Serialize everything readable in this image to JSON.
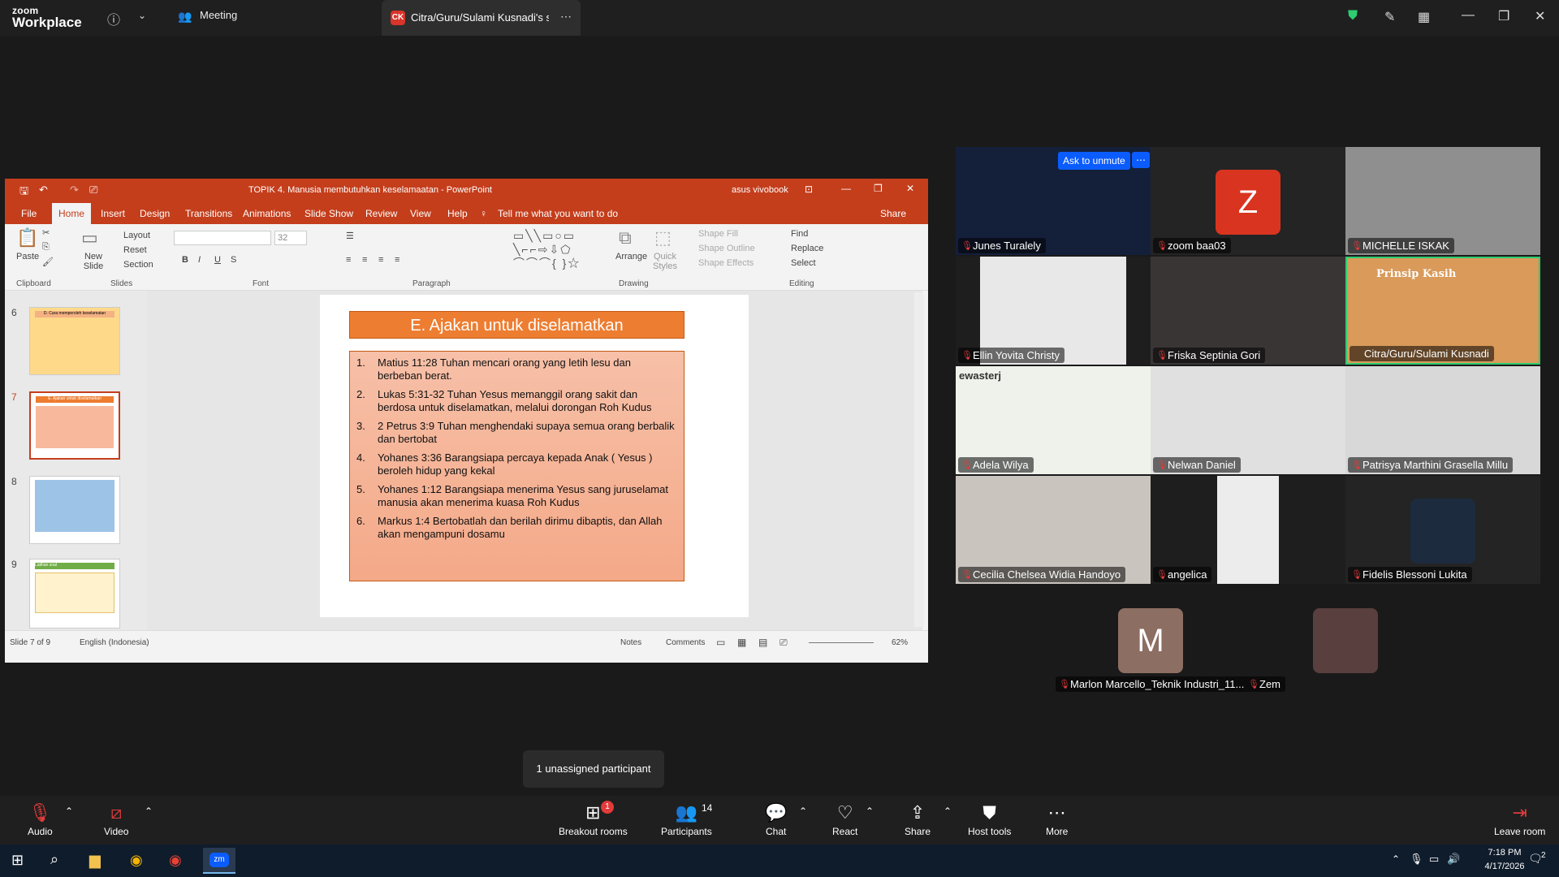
{
  "zoom": {
    "brand_line1": "zoom",
    "brand_line2": "Workplace",
    "meeting_tab": "Meeting",
    "share_tab_badge": "CK",
    "share_tab_label": "Citra/Guru/Sulami Kusnadi's scree"
  },
  "ppt": {
    "window_title": "TOPIK 4. Manusia membutuhkan keselamaatan  -  PowerPoint",
    "user": "asus vivobook",
    "menu": [
      "File",
      "Home",
      "Insert",
      "Design",
      "Transitions",
      "Animations",
      "Slide Show",
      "Review",
      "View",
      "Help"
    ],
    "tell_me": "Tell me what you want to do",
    "share": "Share",
    "ribbon": {
      "paste": "Paste",
      "new_slide": "New Slide",
      "layout": "Layout",
      "reset": "Reset",
      "section": "Section",
      "font_size": "32",
      "arrange": "Arrange",
      "quick_styles": "Quick Styles",
      "shape_fill": "Shape Fill",
      "shape_outline": "Shape Outline",
      "shape_effects": "Shape Effects",
      "find": "Find",
      "replace": "Replace",
      "select": "Select",
      "groups": [
        "Clipboard",
        "Slides",
        "Font",
        "Paragraph",
        "Drawing",
        "Editing"
      ]
    },
    "thumbnails": [
      {
        "num": "6",
        "title": "D. Cara memperoleh keselamatan"
      },
      {
        "num": "7",
        "title": "E. Ajakan untuk diselamatkan"
      },
      {
        "num": "8",
        "title": ""
      },
      {
        "num": "9",
        "title": "Latihan soal"
      }
    ],
    "slide": {
      "title": "E. Ajakan untuk diselamatkan",
      "items": [
        {
          "n": "1.",
          "text": "Matius 11:28  Tuhan mencari orang yang letih lesu dan berbeban berat."
        },
        {
          "n": "2.",
          "text": "Lukas 5:31-32 Tuhan Yesus memanggil orang sakit dan berdosa untuk diselamatkan, melalui dorongan Roh Kudus"
        },
        {
          "n": "3.",
          "text": "2 Petrus 3:9  Tuhan menghendaki supaya semua orang berbalik dan bertobat"
        },
        {
          "n": "4.",
          "text": "Yohanes 3:36 Barangsiapa percaya kepada Anak ( Yesus ) beroleh hidup yang kekal"
        },
        {
          "n": "5.",
          "text": "Yohanes 1:12 Barangsiapa menerima Yesus sang juruselamat manusia akan menerima kuasa Roh Kudus"
        },
        {
          "n": "6.",
          "text": "Markus 1:4 Bertobatlah dan berilah dirimu dibaptis, dan Allah akan mengampuni dosamu"
        }
      ]
    },
    "status": {
      "slide_of": "Slide 7 of 9",
      "language": "English (Indonesia)",
      "notes": "Notes",
      "comments": "Comments",
      "zoom": "62%"
    }
  },
  "gallery": {
    "ask_unmute": "Ask to unmute",
    "participants": [
      {
        "name": "Junes Turalely"
      },
      {
        "name": "zoom baa03",
        "initial": "Z"
      },
      {
        "name": "MICHELLE ISKAK"
      },
      {
        "name": "Ellin Yovita Christy"
      },
      {
        "name": "Friska Septinia Gori"
      },
      {
        "name": "Citra/Guru/Sulami Kusnadi",
        "overlay": "Prinsip Kasih"
      },
      {
        "name": "Adela Wilya",
        "overlay": "ewasterj"
      },
      {
        "name": "Nelwan Daniel"
      },
      {
        "name": "Patrisya Marthini Grasella Millu"
      },
      {
        "name": "Cecilia Chelsea Widia Handoyo"
      },
      {
        "name": "angelica"
      },
      {
        "name": "Fidelis Blessoni Lukita"
      },
      {
        "name": "Marlon Marcello_Teknik Industri_11...",
        "initial": "M"
      },
      {
        "name": "Zem"
      }
    ]
  },
  "tooltip": "1 unassigned participant",
  "toolbar": {
    "audio": "Audio",
    "video": "Video",
    "breakout": "Breakout rooms",
    "breakout_badge": "1",
    "participants": "Participants",
    "participants_count": "14",
    "chat": "Chat",
    "react": "React",
    "share": "Share",
    "host_tools": "Host tools",
    "more": "More",
    "leave": "Leave room"
  },
  "taskbar": {
    "time": "7:18 PM",
    "date": "4/17/2026",
    "notif_count": "2"
  },
  "colors": {
    "ppt_accent": "#c43e1c",
    "slide_title_bg": "#ed7d31",
    "active_speaker": "#2ecc71",
    "mute_red": "#e23b3b",
    "zoom_blue": "#0b5cff"
  }
}
